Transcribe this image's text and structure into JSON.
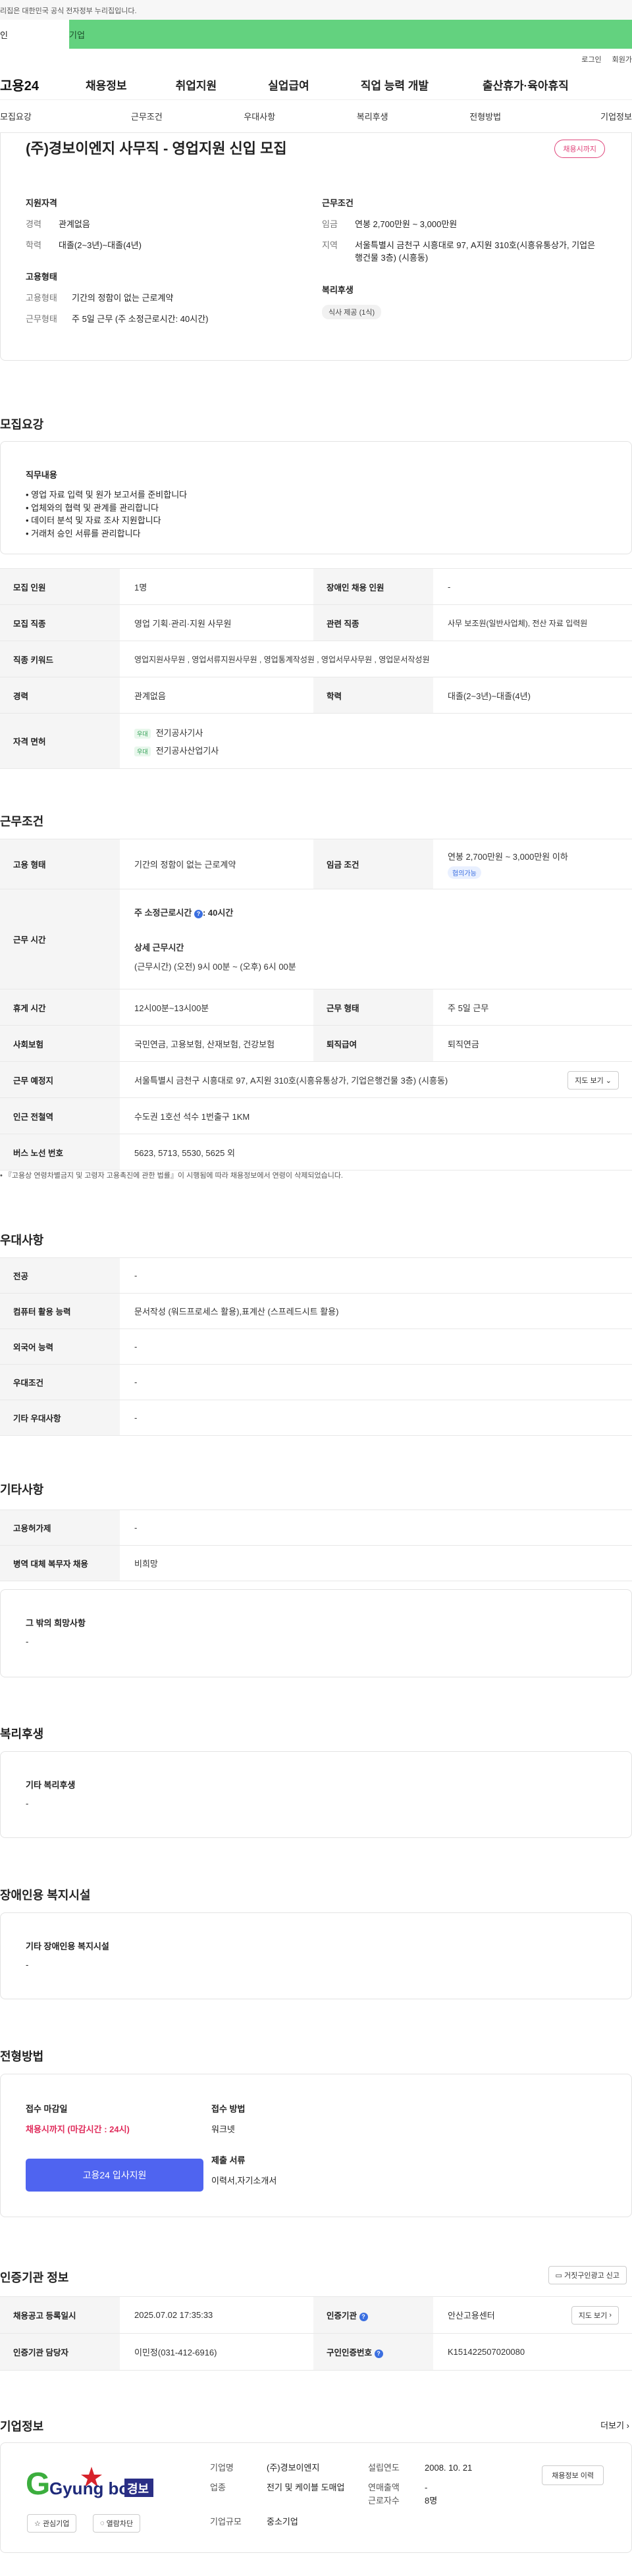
{
  "gov_notice": "이 누리집은 대한민국 공식 전자정부 누리집입니다.",
  "gov_notice_visible": "리집은 대한민국 공식 전자정부 누리집입니다.",
  "green_bar": {
    "left": "인",
    "right": "기업"
  },
  "util": {
    "login": "로그인",
    "join": "회원가"
  },
  "gnb": {
    "logo": "고용24",
    "menus": [
      "채용정보",
      "취업지원",
      "실업급여",
      "직업 능력 개발",
      "출산휴가·육아휴직"
    ]
  },
  "subnav": [
    "모집요강",
    "근무조건",
    "우대사항",
    "복리후생",
    "전형방법",
    "기업정보"
  ],
  "summary": {
    "title": "(주)경보이엔지 사무직 - 영업지원 신입 모집",
    "badge": "채용시까지",
    "qual_title": "지원자격",
    "career_k": "경력",
    "career_v": "관계없음",
    "edu_k": "학력",
    "edu_v": "대졸(2~3년)~대졸(4년)",
    "emp_title": "고용형태",
    "emp_k": "고용형태",
    "emp_v": "기간의 정함이 없는 근로계약",
    "work_k": "근무형태",
    "work_v": "주 5일 근무 (주 소정근로시간: 40시간)",
    "cond_title": "근무조건",
    "wage_k": "임금",
    "wage_v": "연봉 2,700만원 ~ 3,000만원",
    "region_k": "지역",
    "region_v": "서울특별시 금천구 시흥대로 97, A지원 310호(시흥유통상가, 기업은행건물 3층) (시흥동)",
    "welfare_title": "복리후생",
    "welfare_tag": "식사 제공 (1식)"
  },
  "recruit": {
    "title": "모집요강",
    "duty_title": "직무내용",
    "duties": [
      "영업 자료 입력 및 원가 보고서를 준비합니다",
      "업체와의 협력 및 관계를 관리합니다",
      "데이터 분석 및 자료 조사 지원합니다",
      "거래처 승인 서류를 관리합니다"
    ],
    "rows": {
      "headcount_k": "모집 인원",
      "headcount_v": "1명",
      "disabled_k": "장애인 채용 인원",
      "disabled_v": "-",
      "job_k": "모집 직종",
      "job_v": "영업 기획·관리·지원 사무원",
      "related_k": "관련 직종",
      "related_v": "사무 보조원(일반사업체), 전산 자료 입력원",
      "keyword_k": "직종 키워드",
      "keyword_v": "영업지원사무원 , 영업서류지원사무원 , 영업통계작성원 , 영업서무사무원 , 영업문서작성원",
      "career_k": "경력",
      "career_v": "관계없음",
      "edu_k": "학력",
      "edu_v": "대졸(2~3년)~대졸(4년)",
      "license_k": "자격 면허",
      "license_chip": "우대",
      "licenses": [
        "전기공사기사",
        "전기공사산업기사"
      ]
    }
  },
  "conditions": {
    "title": "근무조건",
    "emp_k": "고용 형태",
    "emp_v": "기간의 정함이 없는 근로계약",
    "wage_k": "임금 조건",
    "wage_v": "연봉 2,700만원 ~ 3,000만원 이하",
    "wage_chip": "협의가능",
    "hours_k": "근무 시간",
    "hours_main": "주 소정근로시간",
    "hours_main_v": ": 40시간",
    "hours_detail_title": "상세 근무시간",
    "hours_detail": "(근무시간) (오전) 9시 00분 ~ (오후) 6시 00분",
    "break_k": "휴게 시간",
    "break_v": "12시00분~13시00분",
    "worktype_k": "근무 형태",
    "worktype_v": "주 5일 근무",
    "insurance_k": "사회보험",
    "insurance_v": "국민연금, 고용보험, 산재보험, 건강보험",
    "retire_k": "퇴직급여",
    "retire_v": "퇴직연금",
    "place_k": "근무 예정지",
    "place_v": "서울특별시 금천구 시흥대로 97, A지원 310호(시흥유통상가, 기업은행건물 3층) (시흥동)",
    "map_btn": "지도 보기",
    "subway_k": "인근 전철역",
    "subway_v": "수도권 1호선 석수 1번출구 1KM",
    "bus_k": "버스 노선 번호",
    "bus_v": "5623, 5713, 5530, 5625 외",
    "note": "『고용상 연령차별금지 및 고령자 고용촉진에 관한 법률』이 시행됨에 따라 채용정보에서 연령이 삭제되었습니다."
  },
  "preference": {
    "title": "우대사항",
    "major_k": "전공",
    "major_v": "-",
    "computer_k": "컴퓨터 활용 능력",
    "computer_v": "문서작성 (워드프로세스 활용),표계산 (스프레드시트 활용)",
    "lang_k": "외국어 능력",
    "lang_v": "-",
    "cond_k": "우대조건",
    "cond_v": "-",
    "etc_k": "기타 우대사항",
    "etc_v": "-"
  },
  "other": {
    "title": "기타사항",
    "permit_k": "고용허가제",
    "permit_v": "-",
    "military_k": "병역 대체 복무자 채용",
    "military_v": "비희망",
    "wish_title": "그 밖의 희망사항",
    "wish_v": "-"
  },
  "welfare": {
    "title": "복리후생",
    "box_title": "기타 복리후생",
    "box_v": "-"
  },
  "disabled": {
    "title": "장애인용 복지시설",
    "box_title": "기타 장애인용 복지시설",
    "box_v": "-"
  },
  "selection": {
    "title": "전형방법",
    "deadline_title": "접수 마감일",
    "deadline_v": "채용시까지 (마감시간 : 24시)",
    "apply_btn": "고용24 입사지원",
    "method_title": "접수 방법",
    "method_v": "워크넷",
    "docs_title": "제출 서류",
    "docs_v": "이력서,자기소개서"
  },
  "cert": {
    "title": "인증기관 정보",
    "report_btn": "거짓구인광고 신고",
    "reg_k": "채용공고 등록일시",
    "reg_v": "2025.07.02 17:35:33",
    "agency_k": "인증기관",
    "agency_v": "안산고용센터",
    "map_btn": "지도 보기",
    "manager_k": "인증기관 담당자",
    "manager_v": "이민정(031-412-6916)",
    "reqno_k": "구인인증번호",
    "reqno_v": "K151422507020080"
  },
  "company": {
    "title": "기업정보",
    "more": "더보기",
    "logo_text": "Gyung bo",
    "logo_ko": "경보",
    "fav_btn": "관심기업",
    "block_btn": "열람차단",
    "name_k": "기업명",
    "name_v": "(주)경보이엔지",
    "industry_k": "업종",
    "industry_v": "전기 및 케이블 도매업",
    "size_k": "기업규모",
    "size_v": "중소기업",
    "founded_k": "설립연도",
    "founded_v": "2008. 10. 21",
    "sales_k": "연매출액",
    "sales_v": "-",
    "staff_k": "근로자수",
    "staff_v": "8명",
    "history_btn": "채용정보 이력"
  },
  "colors": {
    "green": "#63d27f",
    "pink": "#e0457b",
    "blue": "#4f64f0",
    "red": "#e02b5b"
  }
}
